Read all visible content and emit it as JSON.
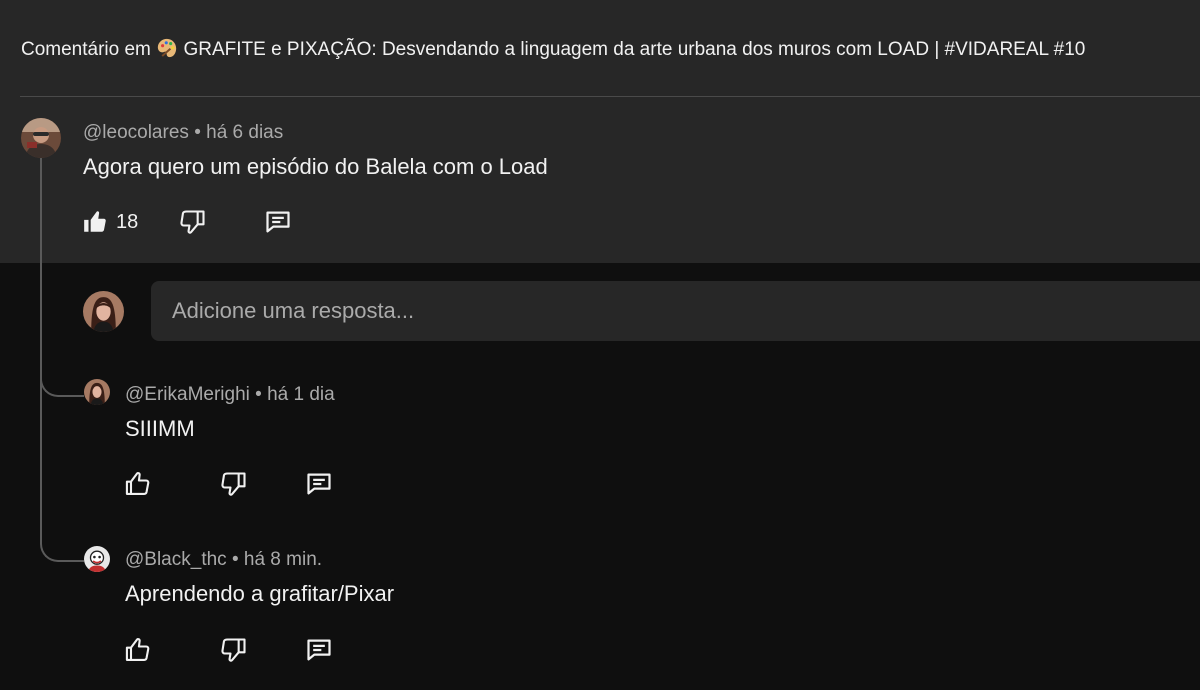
{
  "header": {
    "prefix": "Comentário em",
    "video_title": "GRAFITE e PIXAÇÃO: Desvendando a linguagem da arte urbana dos muros com LOAD | #VIDAREAL #10",
    "icon": "artist-palette-icon"
  },
  "comment": {
    "author": "@leocolares",
    "time": "há 6 dias",
    "text": "Agora quero um episódio do Balela com o Load",
    "likes": "18",
    "liked": true
  },
  "reply_box": {
    "placeholder": "Adicione uma resposta..."
  },
  "replies": [
    {
      "author": "@ErikaMerighi",
      "time": "há 1 dia",
      "text": "SIIIMM"
    },
    {
      "author": "@Black_thc",
      "time": "há 8 min.",
      "text": "Aprendendo a grafitar/Pixar"
    }
  ],
  "separator": "•",
  "icons": {
    "like": "thumbs-up-icon",
    "dislike": "thumbs-down-icon",
    "reply": "reply-comment-icon"
  },
  "colors": {
    "background": "#0f0f0f",
    "top_section": "#272727",
    "text_primary": "#f1f1f1",
    "text_secondary": "#aaaaaa"
  }
}
